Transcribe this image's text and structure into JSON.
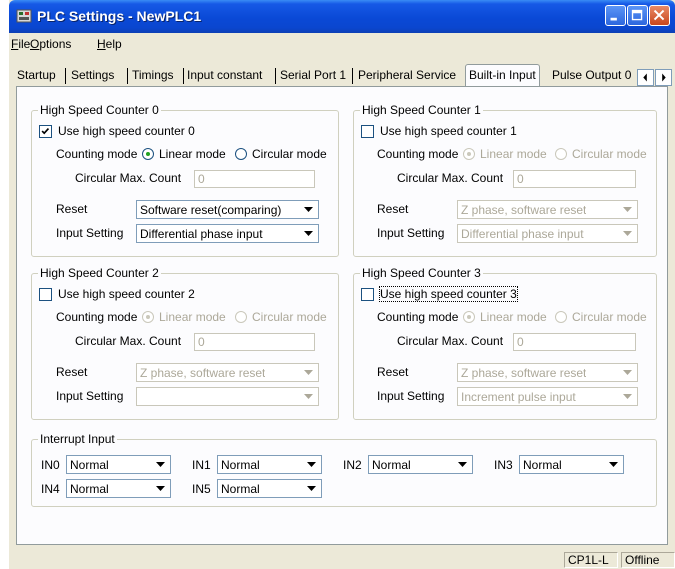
{
  "window": {
    "title": "PLC Settings - NewPLC1"
  },
  "menu": [
    {
      "label": "File",
      "accel": "F",
      "rest": "ile"
    },
    {
      "label": "Options",
      "accel": "O",
      "rest": "ptions"
    },
    {
      "label": "Help",
      "accel": "H",
      "rest": "elp"
    }
  ],
  "tabs": {
    "items": [
      "Startup",
      "Settings",
      "Timings",
      "Input constant",
      "Serial Port 1",
      "Peripheral Service",
      "Built-in Input",
      "Pulse Output 0"
    ],
    "active": "Built-in Input"
  },
  "labels": {
    "counting_mode": "Counting mode",
    "linear_mode": "Linear mode",
    "circular_mode": "Circular mode",
    "circular_max": "Circular Max. Count",
    "reset": "Reset",
    "input_setting": "Input Setting"
  },
  "counters": [
    {
      "title": "High Speed Counter 0",
      "checkbox": "Use high speed counter 0",
      "checked": true,
      "counting_mode": "Linear mode",
      "circular_max": "0",
      "reset": "Software reset(comparing)",
      "input_setting": "Differential phase input"
    },
    {
      "title": "High Speed Counter 1",
      "checkbox": "Use high speed counter 1",
      "checked": false,
      "counting_mode": "Linear mode",
      "circular_max": "0",
      "reset": "Z phase, software reset",
      "input_setting": "Differential phase input"
    },
    {
      "title": "High Speed Counter 2",
      "checkbox": "Use high speed counter 2",
      "checked": false,
      "counting_mode": "Linear mode",
      "circular_max": "0",
      "reset": "Z phase, software reset",
      "input_setting": ""
    },
    {
      "title": "High Speed Counter 3",
      "checkbox": "Use high speed counter 3",
      "checked": false,
      "counting_mode": "Linear mode",
      "circular_max": "0",
      "reset": "Z phase, software reset",
      "input_setting": "Increment pulse input"
    }
  ],
  "interrupt": {
    "title": "Interrupt Input",
    "inputs": [
      {
        "label": "IN0",
        "value": "Normal"
      },
      {
        "label": "IN1",
        "value": "Normal"
      },
      {
        "label": "IN2",
        "value": "Normal"
      },
      {
        "label": "IN3",
        "value": "Normal"
      },
      {
        "label": "IN4",
        "value": "Normal"
      },
      {
        "label": "IN5",
        "value": "Normal"
      }
    ]
  },
  "status": {
    "model": "CP1L-L",
    "connection": "Offline"
  },
  "colors": {
    "title_bar": "#0a49d6",
    "window_bg": "#ece9d8",
    "close_button": "#c8461d"
  },
  "icons": [
    "plc-app-icon",
    "minimize-icon",
    "maximize-icon",
    "close-icon",
    "chevron-left-icon",
    "chevron-right-icon",
    "chevron-down-icon"
  ]
}
